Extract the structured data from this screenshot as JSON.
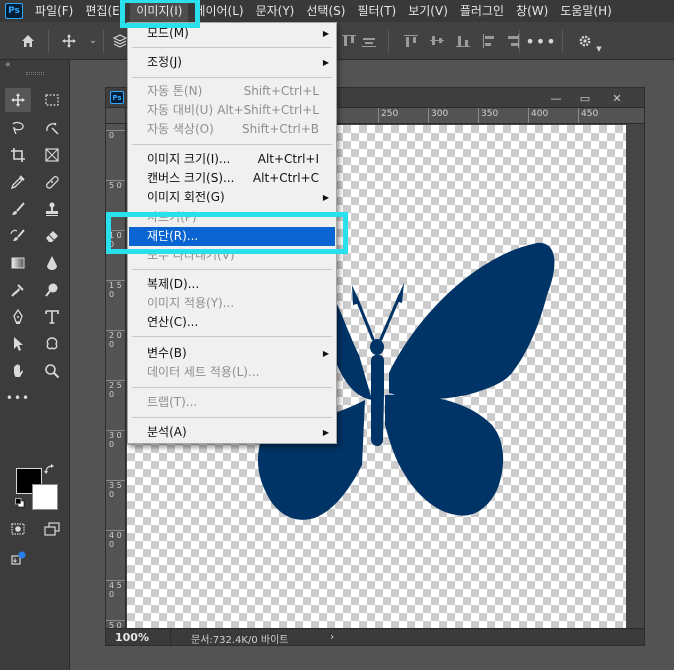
{
  "menubar": {
    "logo": "Ps",
    "items": [
      "파일(F)",
      "편집(E)",
      "이미지(I)",
      "레이어(L)",
      "문자(Y)",
      "선택(S)",
      "필터(T)",
      "보기(V)",
      "플러그인",
      "창(W)",
      "도움말(H)"
    ]
  },
  "options_bar": {
    "icons": [
      "home-icon",
      "move-icon",
      "layers-3d-icon",
      "align-icon",
      "more-icon",
      "settings-icon"
    ]
  },
  "toolbar": {
    "collapse": "«",
    "tools": [
      "move",
      "marquee",
      "lasso",
      "object-select",
      "crop",
      "frame",
      "eyedropper",
      "healing",
      "brush",
      "stamp",
      "history-brush",
      "eraser",
      "gradient",
      "blur",
      "dodge",
      "pen",
      "type",
      "path-select",
      "shape",
      "hand",
      "zoom",
      "more"
    ],
    "foreground_color": "#000000",
    "background_color": "#ffffff"
  },
  "document": {
    "logo": "Ps",
    "zoom": "100%",
    "status": "문서:732.4K/0 바이트",
    "status_arrow": "›",
    "win_minimize": "—",
    "win_restore": "▭",
    "win_close": "✕",
    "ruler_top": [
      "250",
      "300",
      "350",
      "400",
      "450"
    ],
    "ruler_left": [
      "0",
      "5 0",
      "1 0 0",
      "1 5 0",
      "2 0 0",
      "2 5 0",
      "3 0 0",
      "3 5 0",
      "4 0 0",
      "4 5 0",
      "5 0 0"
    ],
    "butterfly_color": "#003366"
  },
  "image_menu": {
    "items": [
      {
        "label": "모드(M)",
        "submenu": true,
        "enabled": true
      },
      {
        "label": "조정(J)",
        "submenu": true,
        "enabled": true
      },
      {
        "label": "자동 톤(N)",
        "shortcut": "Shift+Ctrl+L",
        "enabled": false
      },
      {
        "label": "자동 대비(U)",
        "shortcut": "Alt+Shift+Ctrl+L",
        "enabled": false
      },
      {
        "label": "자동 색상(O)",
        "shortcut": "Shift+Ctrl+B",
        "enabled": false
      },
      {
        "label": "이미지 크기(I)...",
        "shortcut": "Alt+Ctrl+I",
        "enabled": true
      },
      {
        "label": "캔버스 크기(S)...",
        "shortcut": "Alt+Ctrl+C",
        "enabled": true
      },
      {
        "label": "이미지 회전(G)",
        "submenu": true,
        "enabled": true
      },
      {
        "label": "자르기(P)",
        "enabled": false
      },
      {
        "label": "재단(R)...",
        "enabled": true,
        "highlighted": true
      },
      {
        "label": "모두 나타내기(V)",
        "enabled": false
      },
      {
        "label": "복제(D)...",
        "enabled": true
      },
      {
        "label": "이미지 적용(Y)...",
        "enabled": false
      },
      {
        "label": "연산(C)...",
        "enabled": true
      },
      {
        "label": "변수(B)",
        "submenu": true,
        "enabled": true
      },
      {
        "label": "데이터 세트 적용(L)...",
        "enabled": false
      },
      {
        "label": "트랩(T)...",
        "enabled": false
      },
      {
        "label": "분석(A)",
        "submenu": true,
        "enabled": true
      }
    ],
    "submenu_arrow": "▶"
  },
  "annotations": {
    "highlight_color": "#28e1ec"
  }
}
